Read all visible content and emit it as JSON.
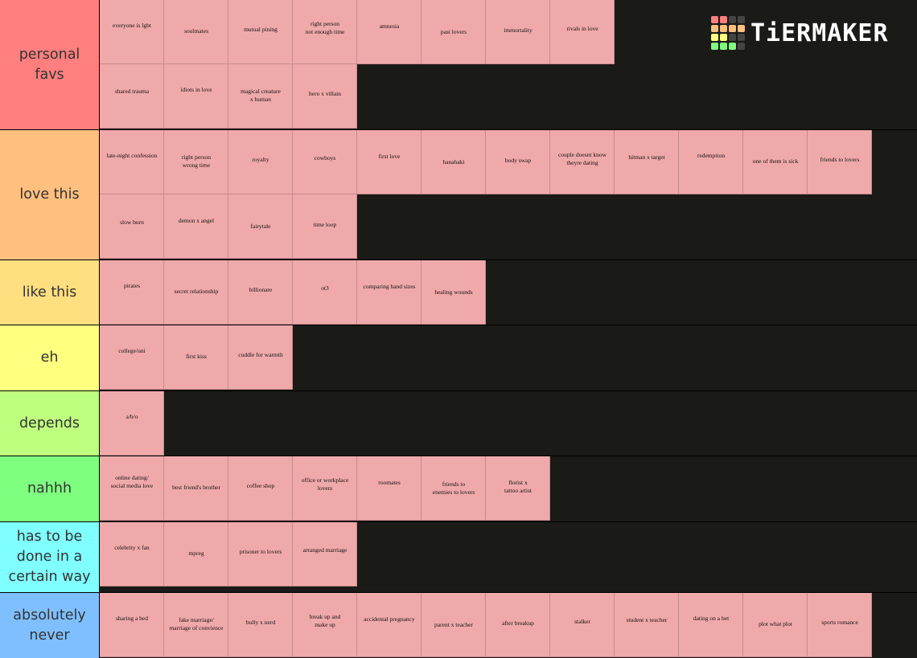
{
  "branding": {
    "logo_text": "TiERMAKER",
    "logo_grid_colors": [
      "#ff7f7f",
      "#ff7f7f",
      "#444444",
      "#444444",
      "#ffbf7f",
      "#ffbf7f",
      "#ffbf7f",
      "#ffbf7f",
      "#ffff7f",
      "#ffff7f",
      "#444444",
      "#444444",
      "#7fff7f",
      "#7fff7f",
      "#7fff7f",
      "#444444"
    ]
  },
  "colors": {
    "tile_bg": "#f0a9aa",
    "row_bg": "#1a1a17"
  },
  "tiers": [
    {
      "label": "personal favs",
      "color": "#ff7f7f",
      "items": [
        "everyone is lgbt",
        "soulmates",
        "mutual pining",
        "right person\nnot enough time",
        "amnesia",
        "past lovers",
        "immortality",
        "rivals in love",
        "shared trauma",
        "idiots in love",
        "magical creature\nx human",
        "hero x villain"
      ]
    },
    {
      "label": "love this",
      "color": "#ffbf7f",
      "items": [
        "late-night confession",
        "right person\nwrong time",
        "royalty",
        "cowboys",
        "first love",
        "hanahaki",
        "body swap",
        "couple doesnt know\ntheyre dating",
        "hitman x target",
        "redemption",
        "one of them is sick",
        "friends to lovers",
        "slow burn",
        "demon x angel",
        "fairytale",
        "time loop"
      ]
    },
    {
      "label": "like this",
      "color": "#ffdf7f",
      "items": [
        "pirates",
        "secret relationship",
        "billionare",
        "ot3",
        "comparing hand sizes",
        "healing wounds"
      ]
    },
    {
      "label": "eh",
      "color": "#ffff7f",
      "items": [
        "college/uni",
        "first kiss",
        "cuddle for warmth"
      ]
    },
    {
      "label": "depends",
      "color": "#bfff7f",
      "items": [
        "a/b/o"
      ]
    },
    {
      "label": "nahhh",
      "color": "#7fff7f",
      "items": [
        "online dating/\nsocial media love",
        "best friend's brother",
        "coffee shop",
        "office or workplace lovers",
        "roomates",
        "friends to\nenemies to lovers",
        "florist x\ntattoo artist"
      ]
    },
    {
      "label": "has to be done in a certain way",
      "color": "#7fffff",
      "items": [
        "celebrity x fan",
        "mpreg",
        "prisoner to lovers",
        "arranged marriage"
      ]
    },
    {
      "label": "absolutely never",
      "color": "#7fbfff",
      "items": [
        "sharing a bed",
        "fake marriage/\nmarriage of convience",
        "bully x nerd",
        "break up and\nmake up",
        "accidental pregnancy",
        "parent x teacher",
        "after breakup",
        "stalker",
        "student x teacher",
        "dating on a bet",
        "plot what plot",
        "sports romance"
      ]
    }
  ]
}
